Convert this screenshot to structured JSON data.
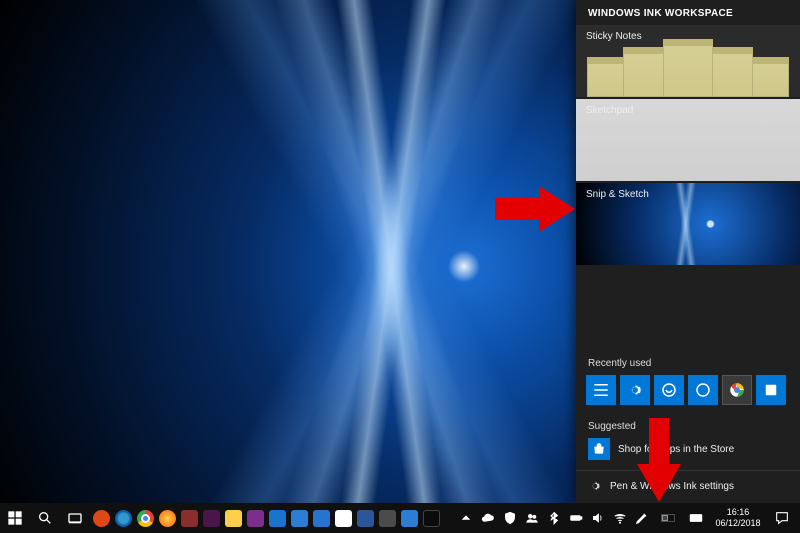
{
  "panel": {
    "title": "WINDOWS INK WORKSPACE",
    "sticky_label": "Sticky Notes",
    "sketchpad_label": "Sketchpad",
    "snip_label": "Snip & Sketch",
    "recent_label": "Recently used",
    "suggested_label": "Suggested",
    "suggested_text": "Shop for apps in the Store",
    "settings_text": "Pen & Windows Ink settings"
  },
  "tray": {
    "time": "16:16",
    "date": "06/12/2018"
  },
  "icons": {
    "start": "start-icon",
    "search": "search-icon",
    "taskview": "task-view-icon",
    "chevron_up": "chevron-up-icon",
    "onedrive": "cloud-icon",
    "security": "shield-icon",
    "people": "people-icon",
    "bluetooth": "bluetooth-icon",
    "power": "battery-icon",
    "volume": "volume-icon",
    "wifi": "wifi-icon",
    "pen": "pen-icon",
    "language": "language-indicator",
    "keyboard": "touch-keyboard-icon",
    "notifications": "notification-icon",
    "gear": "gear-icon",
    "store": "store-icon"
  },
  "recent_apps": [
    {
      "name": "tile-bars"
    },
    {
      "name": "tile-gear"
    },
    {
      "name": "tile-loop"
    },
    {
      "name": "tile-circle"
    },
    {
      "name": "tile-chrome"
    },
    {
      "name": "tile-word"
    }
  ],
  "taskbar_apps": [
    {
      "name": "ubuntu",
      "bg": "#dd4814"
    },
    {
      "name": "edge",
      "bg": "#0b5ca8"
    },
    {
      "name": "chrome",
      "bg": "#ffffff"
    },
    {
      "name": "firefox",
      "bg": "#ff7f1a"
    },
    {
      "name": "app-red",
      "bg": "#8b2d2d"
    },
    {
      "name": "slack",
      "bg": "#4a154b"
    },
    {
      "name": "file-explorer",
      "bg": "#ffcf4b"
    },
    {
      "name": "onenote",
      "bg": "#7c2e8c"
    },
    {
      "name": "outlook",
      "bg": "#1a73cf"
    },
    {
      "name": "todo",
      "bg": "#2c7dd4"
    },
    {
      "name": "azure",
      "bg": "#2673d0"
    },
    {
      "name": "whiteboard",
      "bg": "#fff"
    },
    {
      "name": "word",
      "bg": "#2b579a"
    },
    {
      "name": "sublime",
      "bg": "#4b4b4b"
    },
    {
      "name": "code",
      "bg": "#2c7dd4"
    },
    {
      "name": "terminal",
      "bg": "#0b0b0b"
    }
  ]
}
